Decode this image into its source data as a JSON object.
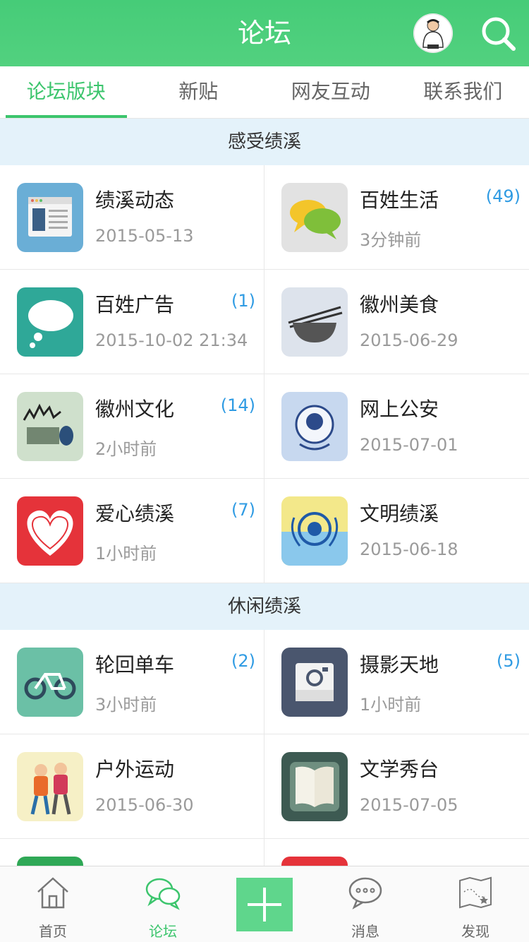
{
  "header": {
    "title": "论坛"
  },
  "tabs": [
    {
      "label": "论坛版块",
      "active": true
    },
    {
      "label": "新贴"
    },
    {
      "label": "网友互动"
    },
    {
      "label": "联系我们"
    }
  ],
  "sections": [
    {
      "title": "感受绩溪",
      "items": [
        {
          "name": "绩溪动态",
          "meta": "2015-05-13",
          "count": "",
          "icon": "news-page-icon"
        },
        {
          "name": "百姓生活",
          "meta": "3分钟前",
          "count": "(49)",
          "icon": "chat-bubbles-icon"
        },
        {
          "name": "百姓广告",
          "meta": "2015-10-02 21:34",
          "count": "(1)",
          "icon": "speech-cloud-icon"
        },
        {
          "name": "徽州美食",
          "meta": "2015-06-29",
          "count": "",
          "icon": "bowl-chopsticks-icon"
        },
        {
          "name": "徽州文化",
          "meta": "2小时前",
          "count": "(14)",
          "icon": "hui-culture-icon"
        },
        {
          "name": "网上公安",
          "meta": "2015-07-01",
          "count": "",
          "icon": "police-badge-icon"
        },
        {
          "name": "爱心绩溪",
          "meta": "1小时前",
          "count": "(7)",
          "icon": "heart-icon"
        },
        {
          "name": "文明绩溪",
          "meta": "2015-06-18",
          "count": "",
          "icon": "civility-emblem-icon"
        }
      ]
    },
    {
      "title": "休闲绩溪",
      "items": [
        {
          "name": "轮回单车",
          "meta": "3小时前",
          "count": "(2)",
          "icon": "bicycle-icon"
        },
        {
          "name": "摄影天地",
          "meta": "1小时前",
          "count": "(5)",
          "icon": "camera-icon"
        },
        {
          "name": "户外运动",
          "meta": "2015-06-30",
          "count": "",
          "icon": "hikers-icon"
        },
        {
          "name": "文学秀台",
          "meta": "2015-07-05",
          "count": "",
          "icon": "open-book-icon"
        }
      ]
    }
  ],
  "bottom_nav": [
    {
      "label": "首页",
      "icon": "home-icon"
    },
    {
      "label": "论坛",
      "icon": "forum-bubbles-icon",
      "active": true
    },
    {
      "label": "",
      "icon": "plus-icon"
    },
    {
      "label": "消息",
      "icon": "message-icon"
    },
    {
      "label": "发现",
      "icon": "map-star-icon"
    }
  ],
  "colors": {
    "accent": "#3cc56d",
    "header": "#4fcf7d",
    "count": "#2f9be3",
    "section_bg": "#e4f2fa"
  }
}
